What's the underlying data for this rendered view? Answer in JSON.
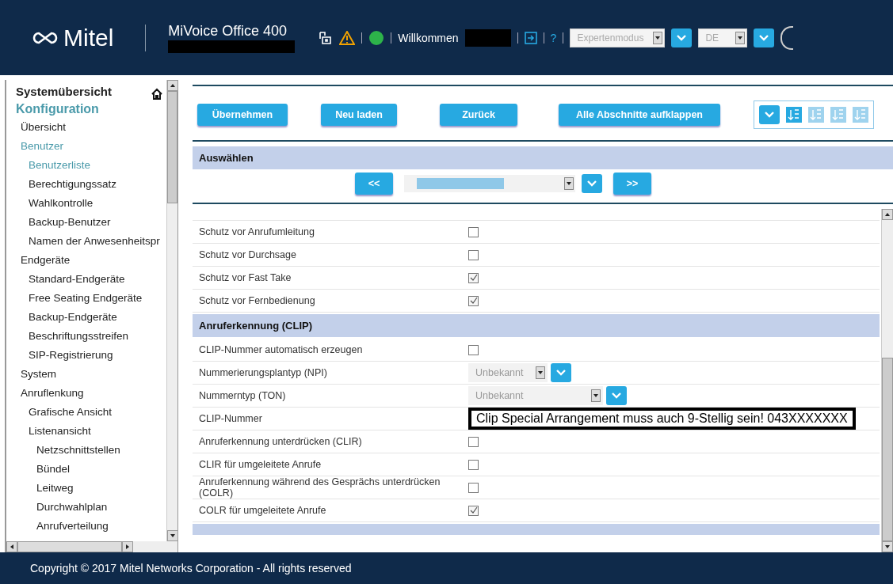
{
  "header": {
    "logo": "Mitel",
    "product": "MiVoice Office 400",
    "welcome": "Willkommen",
    "help": "?",
    "mode_select": "Expertenmodus",
    "lang_select": "DE"
  },
  "sidebar": {
    "items": [
      {
        "label": "Systemübersicht",
        "selected": false
      },
      {
        "label": "Konfiguration",
        "selected": true,
        "children": [
          {
            "label": "Übersicht",
            "selected": false
          },
          {
            "label": "Benutzer",
            "selected": true,
            "children": [
              {
                "label": "Benutzerliste",
                "selected": true
              },
              {
                "label": "Berechtigungssatz",
                "selected": false
              },
              {
                "label": "Wahlkontrolle",
                "selected": false
              },
              {
                "label": "Backup-Benutzer",
                "selected": false
              },
              {
                "label": "Namen der Anwesenheitspr",
                "selected": false
              }
            ]
          },
          {
            "label": "Endgeräte",
            "selected": false,
            "children": [
              {
                "label": "Standard-Endgeräte",
                "selected": false
              },
              {
                "label": "Free Seating Endgeräte",
                "selected": false
              },
              {
                "label": "Backup-Endgeräte",
                "selected": false
              },
              {
                "label": "Beschriftungsstreifen",
                "selected": false
              },
              {
                "label": "SIP-Registrierung",
                "selected": false
              }
            ]
          },
          {
            "label": "System",
            "selected": false
          },
          {
            "label": "Anruflenkung",
            "selected": false,
            "children": [
              {
                "label": "Grafische Ansicht",
                "selected": false
              },
              {
                "label": "Listenansicht",
                "selected": false,
                "children": [
                  {
                    "label": "Netzschnittstellen",
                    "selected": false
                  },
                  {
                    "label": "Bündel",
                    "selected": false
                  },
                  {
                    "label": "Leitweg",
                    "selected": false
                  },
                  {
                    "label": "Durchwahlplan",
                    "selected": false
                  },
                  {
                    "label": "Anrufverteilung",
                    "selected": false
                  }
                ]
              }
            ]
          }
        ]
      }
    ]
  },
  "toolbar": {
    "buttons": [
      "Übernehmen",
      "Neu laden",
      "Zurück",
      "Alle Abschnitte aufklappen"
    ]
  },
  "select_section": {
    "title": "Auswählen",
    "prev": "<<",
    "next": ">>"
  },
  "rows": [
    {
      "kind": "checkbox",
      "label": "Schutz vor Anrufumleitung",
      "checked": false
    },
    {
      "kind": "checkbox",
      "label": "Schutz vor Durchsage",
      "checked": false
    },
    {
      "kind": "checkbox",
      "label": "Schutz vor Fast Take",
      "checked": true
    },
    {
      "kind": "checkbox",
      "label": "Schutz vor Fernbedienung",
      "checked": true
    },
    {
      "kind": "section",
      "label": "Anruferkennung (CLIP)"
    },
    {
      "kind": "checkbox",
      "label": "CLIP-Nummer automatisch erzeugen",
      "checked": false
    },
    {
      "kind": "select",
      "label": "Nummerierungsplantyp (NPI)",
      "value": "Unbekannt",
      "disabled": true,
      "wide": false
    },
    {
      "kind": "select",
      "label": "Nummerntyp (TON)",
      "value": "Unbekannt",
      "disabled": true,
      "wide": true
    },
    {
      "kind": "text",
      "label": "CLIP-Nummer",
      "value": "Clip Special Arrangement muss auch 9-Stellig sein! 043XXXXXXX"
    },
    {
      "kind": "checkbox",
      "label": "Anruferkennung unterdrücken (CLIR)",
      "checked": false
    },
    {
      "kind": "checkbox",
      "label": "CLIR für umgeleitete Anrufe",
      "checked": false
    },
    {
      "kind": "checkbox",
      "label": "Anruferkennung während des Gesprächs unterdrücken (COLR)",
      "checked": false
    },
    {
      "kind": "checkbox",
      "label": "COLR für umgeleitete Anrufe",
      "checked": true
    }
  ],
  "footer": "Copyright © 2017 Mitel Networks Corporation - All rights reserved"
}
